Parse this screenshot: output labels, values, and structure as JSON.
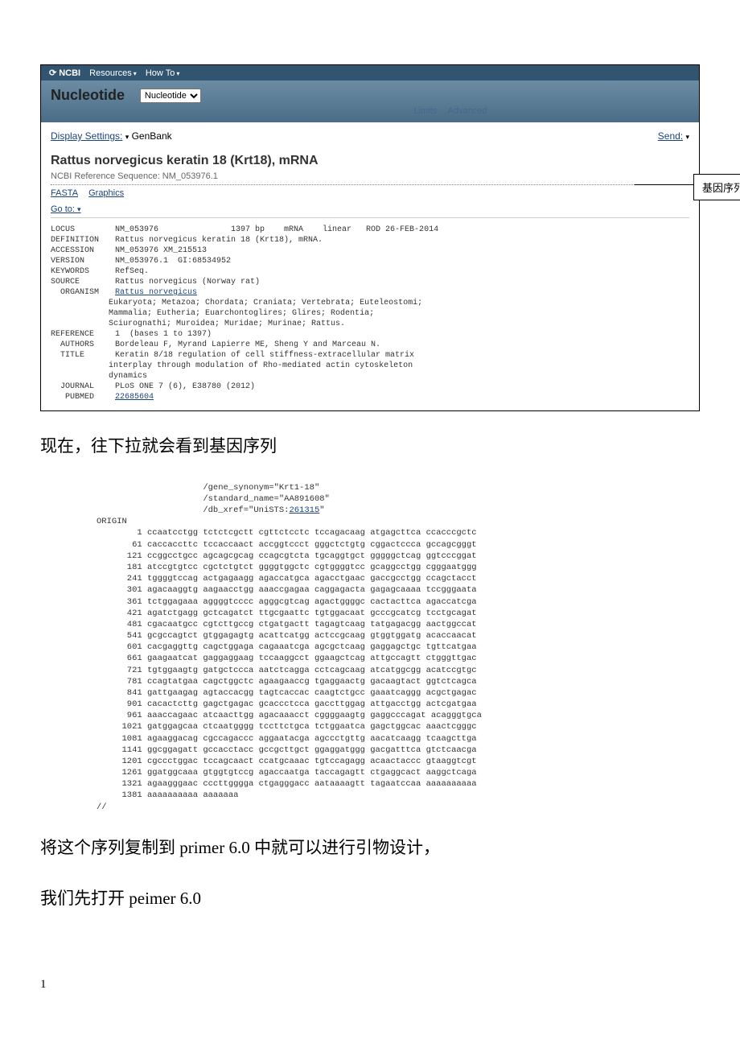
{
  "ncbi_bar": {
    "brand": "NCBI",
    "menu1": "Resources",
    "menu2": "How To"
  },
  "search": {
    "app": "Nucleotide",
    "db": "Nucleotide",
    "limits": "Limits",
    "advanced": "Advanced"
  },
  "display": {
    "label": "Display Settings:",
    "format": "GenBank",
    "send": "Send:"
  },
  "record": {
    "title": "Rattus norvegicus keratin 18 (Krt18), mRNA",
    "ref": "NCBI Reference Sequence: NM_053976.1",
    "fasta": "FASTA",
    "graphics": "Graphics",
    "goto": "Go to:"
  },
  "flat": {
    "locus_k": "LOCUS",
    "locus_v": "NM_053976               1397 bp    mRNA    linear   ROD 26-FEB-2014",
    "def_k": "DEFINITION",
    "def_v": "Rattus norvegicus keratin 18 (Krt18), mRNA.",
    "acc_k": "ACCESSION",
    "acc_v": "NM_053976 XM_215513",
    "ver_k": "VERSION",
    "ver_v": "NM_053976.1  GI:68534952",
    "kw_k": "KEYWORDS",
    "kw_v": "RefSeq.",
    "src_k": "SOURCE",
    "src_v": "Rattus norvegicus (Norway rat)",
    "org_k": "  ORGANISM",
    "org_link": "Rattus norvegicus",
    "org_tax": "Eukaryota; Metazoa; Chordata; Craniata; Vertebrata; Euteleostomi;\n            Mammalia; Eutheria; Euarchontoglires; Glires; Rodentia;\n            Sciurognathi; Muroidea; Muridae; Murinae; Rattus.",
    "ref_k": "REFERENCE",
    "ref_v": "1  (bases 1 to 1397)",
    "auth_k": "  AUTHORS",
    "auth_v": "Bordeleau F, Myrand Lapierre ME, Sheng Y and Marceau N.",
    "title_k": "  TITLE",
    "title_v": "Keratin 8/18 regulation of cell stiffness-extracellular matrix\n            interplay through modulation of Rho-mediated actin cytoskeleton\n            dynamics",
    "jour_k": "  JOURNAL",
    "jour_v": "PLoS ONE 7 (6), E38780 (2012)",
    "pub_k": "   PUBMED",
    "pub_link": "22685604"
  },
  "callout": "基因序列号",
  "body1": "现在，往下拉就会看到基因序列",
  "seq_top": {
    "gene_syn": "/gene_synonym=\"Krt1-18\"",
    "std_name": "/standard_name=\"AA891608\"",
    "db_xref_pre": "/db_xref=\"UniSTS:",
    "db_xref_link": "261315",
    "db_xref_suf": "\"",
    "origin": "ORIGIN"
  },
  "sequence": [
    {
      "n": "1",
      "s": "ccaatcctgg tctctcgctt cgttctcctc tccagacaag atgagcttca ccacccgctc"
    },
    {
      "n": "61",
      "s": "caccaccttc tccaccaact accggtccct gggctctgtg cggactccca gccagcgggt"
    },
    {
      "n": "121",
      "s": "ccggcctgcc agcagcgcag ccagcgtcta tgcaggtgct gggggctcag ggtcccggat"
    },
    {
      "n": "181",
      "s": "atccgtgtcc cgctctgtct ggggtggctc cgtggggtcc gcaggcctgg cgggaatggg"
    },
    {
      "n": "241",
      "s": "tggggtccag actgagaagg agaccatgca agacctgaac gaccgcctgg ccagctacct"
    },
    {
      "n": "301",
      "s": "agacaaggtg aagaacctgg aaaccgagaa caggagacta gagagcaaaa tccgggaata"
    },
    {
      "n": "361",
      "s": "tctggagaaa aggggtcccc agggcgtcag agactggggc cactacttca agaccatcga"
    },
    {
      "n": "421",
      "s": "agatctgagg gctcagatct ttgcgaattc tgtggacaat gcccgcatcg tcctgcagat"
    },
    {
      "n": "481",
      "s": "cgacaatgcc cgtcttgccg ctgatgactt tagagtcaag tatgagacgg aactggccat"
    },
    {
      "n": "541",
      "s": "gcgccagtct gtggagagtg acattcatgg actccgcaag gtggtggatg acaccaacat"
    },
    {
      "n": "601",
      "s": "cacgaggttg cagctggaga cagaaatcga agcgctcaag gaggagctgc tgttcatgaa"
    },
    {
      "n": "661",
      "s": "gaagaatcat gaggaggaag tccaaggcct ggaagctcag attgccagtt ctgggttgac"
    },
    {
      "n": "721",
      "s": "tgtggaagtg gatgctccca aatctcagga cctcagcaag atcatggcgg acatccgtgc"
    },
    {
      "n": "781",
      "s": "ccagtatgaa cagctggctc agaagaaccg tgaggaactg gacaagtact ggtctcagca"
    },
    {
      "n": "841",
      "s": "gattgaagag agtaccacgg tagtcaccac caagtctgcc gaaatcaggg acgctgagac"
    },
    {
      "n": "901",
      "s": "cacactcttg gagctgagac gcaccctcca gaccttggag attgacctgg actcgatgaa"
    },
    {
      "n": "961",
      "s": "aaaccagaac atcaacttgg agacaaacct cggggaagtg gaggcccagat acagggtgca"
    },
    {
      "n": "1021",
      "s": "gatggagcaa ctcaatgggg tccttctgca tctggaatca gagctggcac aaactcgggc"
    },
    {
      "n": "1081",
      "s": "agaaggacag cgccagaccc aggaatacga agccctgttg aacatcaagg tcaagcttga"
    },
    {
      "n": "1141",
      "s": "ggcggagatt gccacctacc gccgcttgct ggaggatggg gacgatttca gtctcaacga"
    },
    {
      "n": "1201",
      "s": "cgccctggac tccagcaact ccatgcaaac tgtccagagg acaactaccc gtaaggtcgt"
    },
    {
      "n": "1261",
      "s": "ggatggcaaa gtggtgtccg agaccaatga taccagagtt ctgaggcact aaggctcaga"
    },
    {
      "n": "1321",
      "s": "agaagggaac cccttgggga ctgagggacc aataaaagtt tagaatccaa aaaaaaaaaa"
    },
    {
      "n": "1381",
      "s": "aaaaaaaaaa aaaaaaa"
    }
  ],
  "seq_end": "//",
  "body2": "将这个序列复制到 primer 6.0 中就可以进行引物设计，",
  "body3": "我们先打开 peimer 6.0",
  "page_num": "1"
}
